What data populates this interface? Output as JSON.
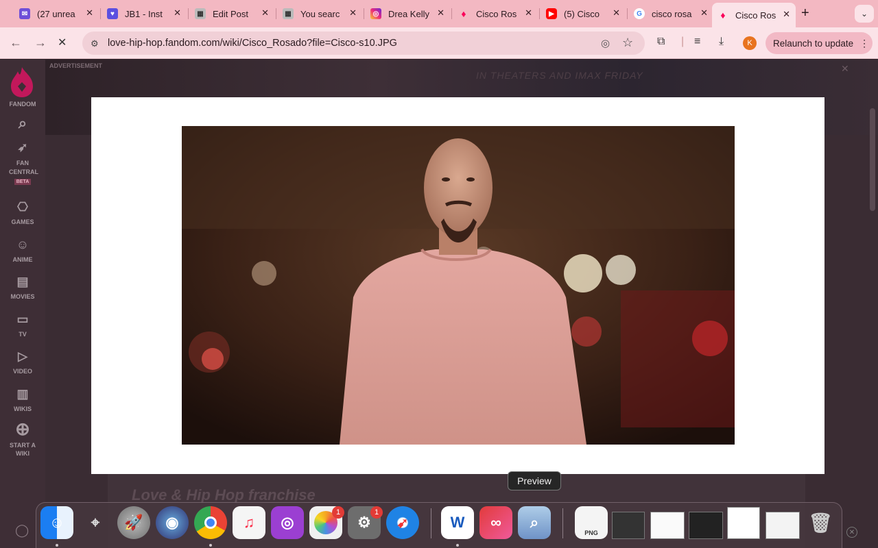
{
  "browser": {
    "tabs": [
      {
        "title": "(27 unrea",
        "icon": "mail-icon",
        "color": "#6e4fd8"
      },
      {
        "title": "JB1 - Inst",
        "icon": "heart-chat-icon",
        "color": "#5b4fe0"
      },
      {
        "title": "Edit Post",
        "icon": "site-icon",
        "color": "#999999"
      },
      {
        "title": "You searc",
        "icon": "site-icon",
        "color": "#999999"
      },
      {
        "title": "Drea Kelly",
        "icon": "instagram-icon",
        "color": "#d6297b"
      },
      {
        "title": "Cisco Ros",
        "icon": "fandom-icon",
        "color": "#fa005a"
      },
      {
        "title": "(5) Cisco",
        "icon": "youtube-icon",
        "color": "#ff0000"
      },
      {
        "title": "cisco rosa",
        "icon": "google-icon",
        "color": "#4285f4"
      },
      {
        "title": "Cisco Ros",
        "icon": "fandom-icon",
        "color": "#fa005a",
        "active": true
      }
    ],
    "url": "love-hip-hop.fandom.com/wiki/Cisco_Rosado?file=Cisco-s10.JPG",
    "profile_initial": "K",
    "relaunch_label": "Relaunch to update"
  },
  "fandom_nav": {
    "logo_label": "FANDOM",
    "items": [
      {
        "label": "FAN CENTRAL",
        "icon": "rocket-icon",
        "badge": "BETA"
      },
      {
        "label": "GAMES",
        "icon": "gamepad-icon"
      },
      {
        "label": "ANIME",
        "icon": "anime-icon"
      },
      {
        "label": "MOVIES",
        "icon": "clapper-icon"
      },
      {
        "label": "TV",
        "icon": "tv-icon"
      },
      {
        "label": "VIDEO",
        "icon": "play-icon"
      },
      {
        "label": "WIKIS",
        "icon": "book-icon"
      },
      {
        "label": "START A WIKI",
        "icon": "plus-circle-icon"
      }
    ]
  },
  "ad": {
    "label": "ADVERTISEMENT",
    "tagline": "IN THEATERS AND IMAX FRIDAY"
  },
  "page": {
    "franchise_heading": "Love & Hip Hop franchise"
  },
  "dock": {
    "tooltip": "Preview",
    "apps": [
      {
        "name": "finder-icon",
        "color": "#1e8ef0"
      },
      {
        "name": "instruments-icon",
        "color": "#55454c"
      },
      {
        "name": "launchpad-icon",
        "color": "#8a8a8a"
      },
      {
        "name": "siri-icon",
        "color": "#3a3a6a"
      },
      {
        "name": "chrome-icon",
        "color": "#e9e9e9"
      },
      {
        "name": "music-icon",
        "color": "#f5f5f5"
      },
      {
        "name": "podcasts-icon",
        "color": "#9b3fd2"
      },
      {
        "name": "photos-icon",
        "color": "#f0f0f0",
        "badge": "1"
      },
      {
        "name": "system-settings-icon",
        "color": "#6d6d6d",
        "badge": "1"
      },
      {
        "name": "safari-icon",
        "color": "#1f83e5"
      },
      {
        "name": "word-icon",
        "color": "#ffffff"
      },
      {
        "name": "creative-cloud-icon",
        "color": "#e23b3b"
      },
      {
        "name": "preview-icon",
        "color": "#8fb0d8"
      }
    ],
    "png_label": "PNG"
  }
}
